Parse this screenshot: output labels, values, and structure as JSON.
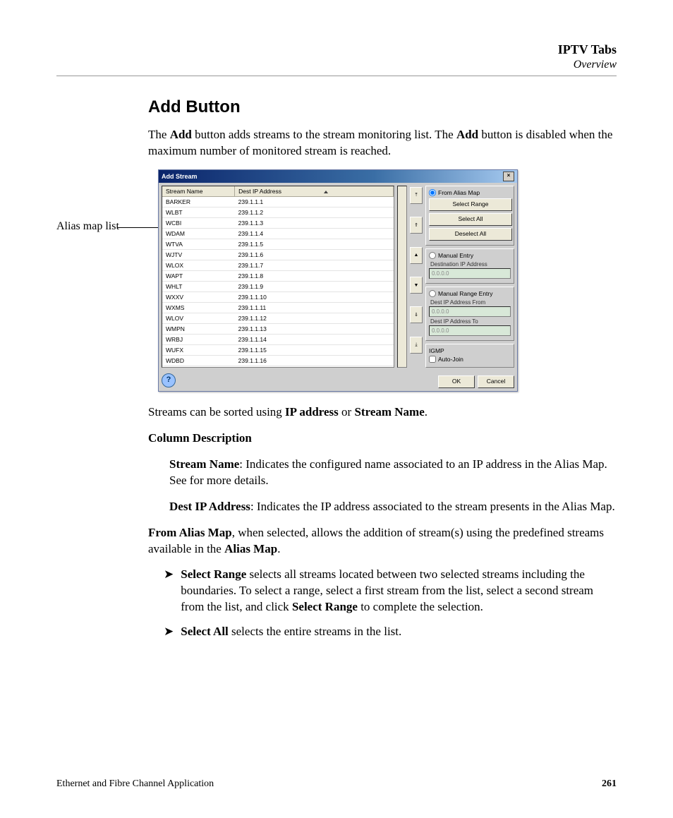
{
  "header": {
    "title": "IPTV Tabs",
    "subtitle": "Overview"
  },
  "section": {
    "heading": "Add Button",
    "intro_pre": "The ",
    "intro_b1": "Add",
    "intro_mid": " button adds streams to the stream monitoring list. The ",
    "intro_b2": "Add",
    "intro_post": " button is disabled when the maximum number of monitored stream is reached."
  },
  "callout": "Alias map list",
  "dialog": {
    "title": "Add Stream",
    "close": "×",
    "columns": {
      "c1": "Stream Name",
      "c2": "Dest IP Address"
    },
    "rows": [
      {
        "name": "BARKER",
        "ip": "239.1.1.1"
      },
      {
        "name": "WLBT",
        "ip": "239.1.1.2"
      },
      {
        "name": "WCBI",
        "ip": "239.1.1.3"
      },
      {
        "name": "WDAM",
        "ip": "239.1.1.4"
      },
      {
        "name": "WTVA",
        "ip": "239.1.1.5"
      },
      {
        "name": "WJTV",
        "ip": "239.1.1.6"
      },
      {
        "name": "WLOX",
        "ip": "239.1.1.7"
      },
      {
        "name": "WAPT",
        "ip": "239.1.1.8"
      },
      {
        "name": "WHLT",
        "ip": "239.1.1.9"
      },
      {
        "name": "WXXV",
        "ip": "239.1.1.10"
      },
      {
        "name": "WXMS",
        "ip": "239.1.1.11"
      },
      {
        "name": "WLOV",
        "ip": "239.1.1.12"
      },
      {
        "name": "WMPN",
        "ip": "239.1.1.13"
      },
      {
        "name": "WRBJ",
        "ip": "239.1.1.14"
      },
      {
        "name": "WUFX",
        "ip": "239.1.1.15"
      },
      {
        "name": "WDBD",
        "ip": "239.1.1.16"
      }
    ],
    "midbtns": [
      "⤒",
      "⇑",
      "▲",
      "▼",
      "⇓",
      "⤓"
    ],
    "from_alias": "From Alias Map",
    "select_range": "Select Range",
    "select_all": "Select All",
    "deselect_all": "Deselect All",
    "manual_entry": "Manual Entry",
    "dest_ip_label": "Destination IP Address",
    "placeholder_ip": "0.0.0.0",
    "manual_range": "Manual Range Entry",
    "dest_from": "Dest IP Address From",
    "dest_to": "Dest IP Address To",
    "igmp": "IGMP",
    "auto_join": "Auto-Join",
    "help": "?",
    "ok": "OK",
    "cancel": "Cancel"
  },
  "after": {
    "sorted_pre": "Streams can be sorted using ",
    "sorted_b1": "IP address",
    "sorted_mid": " or ",
    "sorted_b2": "Stream Name",
    "sorted_post": ".",
    "coldesc_heading": "Column Description",
    "sn_label": "Stream Name",
    "sn_text": ": Indicates the configured name associated to an IP address in the Alias Map. See  for more details.",
    "dip_label": "Dest IP Address",
    "dip_text": ": Indicates the IP address associated to the stream presents in the Alias Map.",
    "fam_label": "From Alias Map",
    "fam_mid": ", when selected, allows the addition of stream(s) using the predefined streams available in the ",
    "fam_b2": "Alias Map",
    "fam_post": ".",
    "sr_label": "Select Range",
    "sr_mid": " selects all streams located between two selected streams including the boundaries. To select a range, select a first stream from the list, select a second stream from the list, and click ",
    "sr_b2": "Select Range",
    "sr_post": " to complete the selection.",
    "sa_label": "Select All",
    "sa_text": " selects the entire streams in the list."
  },
  "footer": {
    "left": "Ethernet and Fibre Channel Application",
    "right": "261"
  }
}
